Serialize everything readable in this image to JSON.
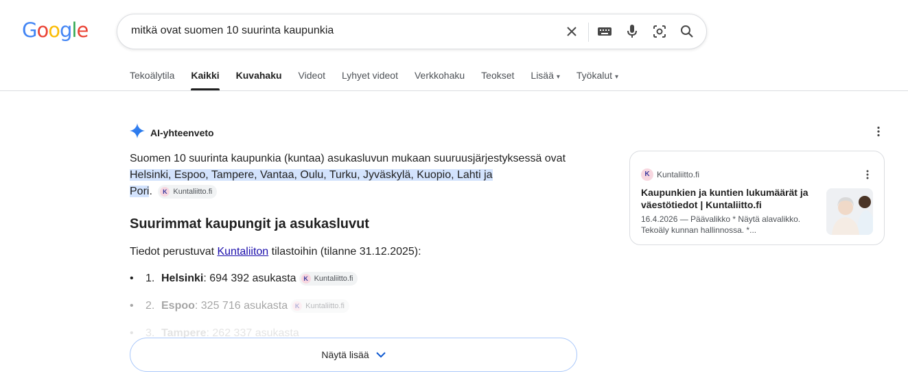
{
  "logo": {
    "text": "Google"
  },
  "search": {
    "query": "mitkä ovat suomen 10 suurinta kaupunkia"
  },
  "tabs": [
    {
      "label": "Tekoälytila"
    },
    {
      "label": "Kaikki"
    },
    {
      "label": "Kuvahaku"
    },
    {
      "label": "Videot"
    },
    {
      "label": "Lyhyet videot"
    },
    {
      "label": "Verkkohaku"
    },
    {
      "label": "Teokset"
    },
    {
      "label": "Lisää"
    },
    {
      "label": "Työkalut"
    }
  ],
  "ai": {
    "title": "AI-yhteenveto",
    "intro": "Suomen 10 suurinta kaupunkia (kuntaa) asukasluvun mukaan suuruusjärjestyksessä ovat",
    "highlight_line1": "Helsinki, Espoo, Tampere, Vantaa, Oulu, Turku, Jyväskylä, Kuopio, Lahti ja",
    "highlight_line2": "Pori",
    "period": ".",
    "chip_label": "Kuntaliitto.fi",
    "heading": "Suurimmat kaupungit ja asukasluvut",
    "para_before": "Tiedot perustuvat ",
    "para_link": "Kuntaliiton",
    "para_after": " tilastoihin (tilanne 31.12.2025):",
    "list": [
      {
        "num": "1.",
        "city": "Helsinki",
        "rest": ": 694 392 asukasta"
      },
      {
        "num": "2.",
        "city": "Espoo",
        "rest": ": 325 716 asukasta"
      },
      {
        "num": "3.",
        "city": "Tampere",
        "rest": ": 262 337 asukasta"
      }
    ],
    "show_more": "Näytä lisää"
  },
  "card": {
    "source": "Kuntaliitto.fi",
    "title": "Kaupunkien ja kuntien lukumäärät ja väestötiedot | Kuntaliitto.fi",
    "snippet": "16.4.2026 — Päävalikko * Näytä alavalikko. Tekoäly kunnan hallinnossa. *..."
  },
  "colors": {
    "link": "#1a0dab",
    "highlight": "#d3e3fd",
    "button_border": "#a8c7fa"
  },
  "icons": [
    "clear-icon",
    "keyboard-icon",
    "mic-icon",
    "lens-icon",
    "search-icon",
    "sparkle-icon",
    "more-vert-icon",
    "chevron-down-icon"
  ]
}
